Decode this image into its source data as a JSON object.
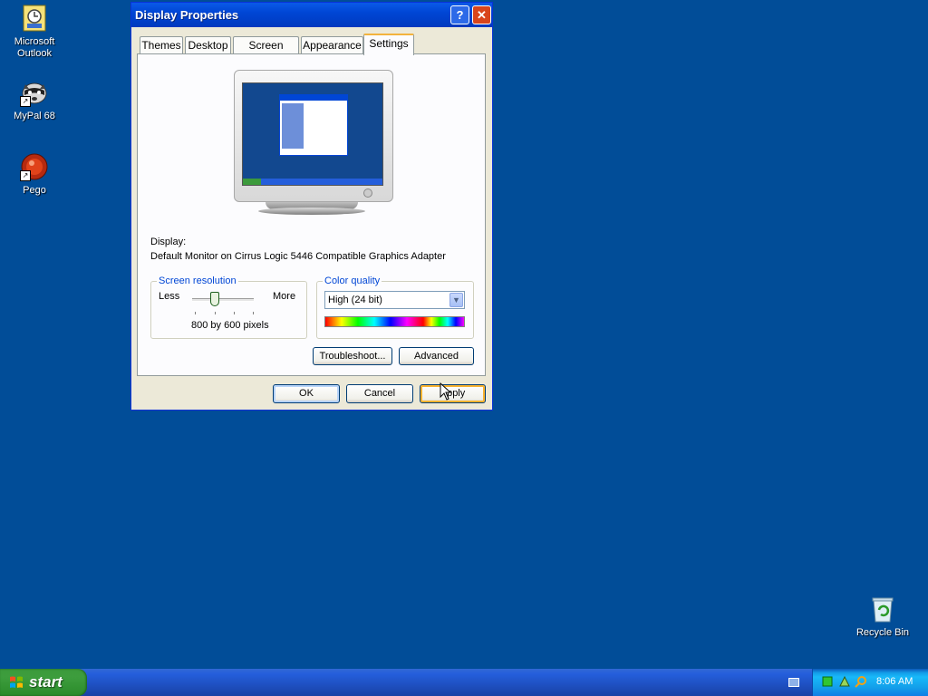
{
  "desktop": {
    "icons": [
      {
        "label_line1": "Microsoft",
        "label_line2": "Outlook",
        "icon": "outlook-icon"
      },
      {
        "label_line1": "MyPal 68",
        "label_line2": "",
        "icon": "raccoon-icon"
      },
      {
        "label_line1": "Pego",
        "label_line2": "",
        "icon": "pego-icon"
      },
      {
        "label_line1": "Recycle Bin",
        "label_line2": "",
        "icon": "recycle-bin-icon"
      }
    ]
  },
  "window": {
    "title": "Display Properties",
    "help_glyph": "?",
    "close_glyph": "✕",
    "tabs": [
      {
        "label": "Themes",
        "active": false
      },
      {
        "label": "Desktop",
        "active": false
      },
      {
        "label": "Screen Saver",
        "active": false
      },
      {
        "label": "Appearance",
        "active": false
      },
      {
        "label": "Settings",
        "active": true
      }
    ],
    "display_label": "Display:",
    "display_value": "Default Monitor on Cirrus Logic 5446 Compatible Graphics Adapter",
    "resolution": {
      "legend": "Screen resolution",
      "less": "Less",
      "more": "More",
      "value_text": "800 by 600 pixels",
      "slider_position": 0.4
    },
    "color_quality": {
      "legend": "Color quality",
      "selected": "High (24 bit)"
    },
    "buttons": {
      "troubleshoot": "Troubleshoot...",
      "advanced": "Advanced",
      "ok": "OK",
      "cancel": "Cancel",
      "apply": "Apply"
    }
  },
  "taskbar": {
    "start_label": "start",
    "clock": "8:06 AM"
  },
  "colors": {
    "desktop_bg": "#014d98",
    "title_bar": "#0046d5",
    "active_tab_highlight": "#f3b33d",
    "start_green": "#3c9a3c"
  }
}
